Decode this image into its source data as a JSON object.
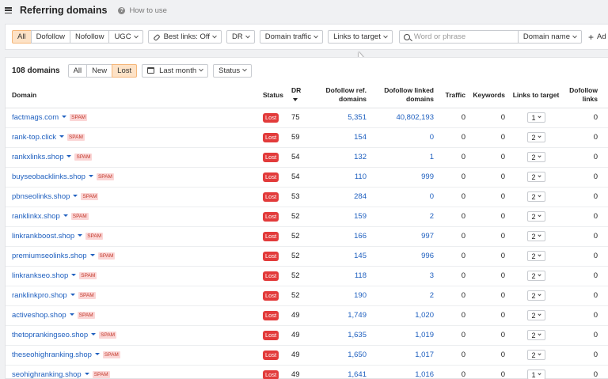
{
  "header": {
    "title": "Referring domains",
    "help_label": "How to use"
  },
  "filters": {
    "link_type": [
      "All",
      "Dofollow",
      "Nofollow"
    ],
    "ugc_label": "UGC",
    "best_links_label": "Best links: Off",
    "dr_label": "DR",
    "domain_traffic_label": "Domain traffic",
    "links_to_target_label": "Links to target",
    "search_placeholder": "Word or phrase",
    "search_scope_label": "Domain name",
    "add_label": "Ad"
  },
  "panel": {
    "count": "108 domains",
    "tabs": [
      "All",
      "New",
      "Lost"
    ],
    "period_label": "Last month",
    "status_label": "Status"
  },
  "columns": {
    "domain": "Domain",
    "status": "Status",
    "dr": "DR",
    "dofollow_ref": "Dofollow ref. domains",
    "dofollow_linked": "Dofollow linked domains",
    "traffic": "Traffic",
    "keywords": "Keywords",
    "links_to_target": "Links to target",
    "dofollow_links": "Dofollow links"
  },
  "rows": [
    {
      "domain": "factmags.com",
      "badge": "SPAM",
      "status": "Lost",
      "dr": "75",
      "ref": "5,351",
      "linked": "40,802,193",
      "traffic": "0",
      "keywords": "0",
      "ltt": "1",
      "dofollow_links": "0"
    },
    {
      "domain": "rank-top.click",
      "badge": "SPAM",
      "status": "Lost",
      "dr": "59",
      "ref": "154",
      "linked": "0",
      "traffic": "0",
      "keywords": "0",
      "ltt": "2",
      "dofollow_links": "0"
    },
    {
      "domain": "rankxlinks.shop",
      "badge": "SPAM",
      "status": "Lost",
      "dr": "54",
      "ref": "132",
      "linked": "1",
      "traffic": "0",
      "keywords": "0",
      "ltt": "2",
      "dofollow_links": "0"
    },
    {
      "domain": "buyseobacklinks.shop",
      "badge": "SPAM",
      "status": "Lost",
      "dr": "54",
      "ref": "110",
      "linked": "999",
      "traffic": "0",
      "keywords": "0",
      "ltt": "2",
      "dofollow_links": "0"
    },
    {
      "domain": "pbnseolinks.shop",
      "badge": "SPAM",
      "status": "Lost",
      "dr": "53",
      "ref": "284",
      "linked": "0",
      "traffic": "0",
      "keywords": "0",
      "ltt": "2",
      "dofollow_links": "0"
    },
    {
      "domain": "ranklinkx.shop",
      "badge": "SPAM",
      "status": "Lost",
      "dr": "52",
      "ref": "159",
      "linked": "2",
      "traffic": "0",
      "keywords": "0",
      "ltt": "2",
      "dofollow_links": "0"
    },
    {
      "domain": "linkrankboost.shop",
      "badge": "SPAM",
      "status": "Lost",
      "dr": "52",
      "ref": "166",
      "linked": "997",
      "traffic": "0",
      "keywords": "0",
      "ltt": "2",
      "dofollow_links": "0"
    },
    {
      "domain": "premiumseolinks.shop",
      "badge": "SPAM",
      "status": "Lost",
      "dr": "52",
      "ref": "145",
      "linked": "996",
      "traffic": "0",
      "keywords": "0",
      "ltt": "2",
      "dofollow_links": "0"
    },
    {
      "domain": "linkrankseo.shop",
      "badge": "SPAM",
      "status": "Lost",
      "dr": "52",
      "ref": "118",
      "linked": "3",
      "traffic": "0",
      "keywords": "0",
      "ltt": "2",
      "dofollow_links": "0"
    },
    {
      "domain": "ranklinkpro.shop",
      "badge": "SPAM",
      "status": "Lost",
      "dr": "52",
      "ref": "190",
      "linked": "2",
      "traffic": "0",
      "keywords": "0",
      "ltt": "2",
      "dofollow_links": "0"
    },
    {
      "domain": "activeshop.shop",
      "badge": "SPAM",
      "status": "Lost",
      "dr": "49",
      "ref": "1,749",
      "linked": "1,020",
      "traffic": "0",
      "keywords": "0",
      "ltt": "2",
      "dofollow_links": "0"
    },
    {
      "domain": "thetoprankingseo.shop",
      "badge": "SPAM",
      "status": "Lost",
      "dr": "49",
      "ref": "1,635",
      "linked": "1,019",
      "traffic": "0",
      "keywords": "0",
      "ltt": "2",
      "dofollow_links": "0"
    },
    {
      "domain": "theseohighranking.shop",
      "badge": "SPAM",
      "status": "Lost",
      "dr": "49",
      "ref": "1,650",
      "linked": "1,017",
      "traffic": "0",
      "keywords": "0",
      "ltt": "2",
      "dofollow_links": "0"
    },
    {
      "domain": "seohighranking.shop",
      "badge": "SPAM",
      "status": "Lost",
      "dr": "49",
      "ref": "1,641",
      "linked": "1,016",
      "traffic": "0",
      "keywords": "0",
      "ltt": "1",
      "dofollow_links": "0"
    }
  ]
}
